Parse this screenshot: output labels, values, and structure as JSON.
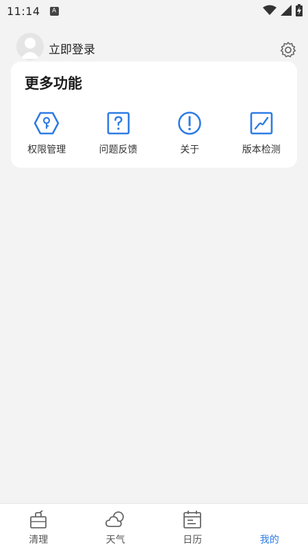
{
  "status_bar": {
    "time": "11:14",
    "notification_badge": "A"
  },
  "header": {
    "login_text": "立即登录"
  },
  "more_functions": {
    "title": "更多功能",
    "items": [
      {
        "label": "权限管理",
        "icon": "permission-key-icon"
      },
      {
        "label": "问题反馈",
        "icon": "feedback-question-icon"
      },
      {
        "label": "关于",
        "icon": "about-exclamation-icon"
      },
      {
        "label": "版本检测",
        "icon": "version-check-chart-icon"
      }
    ]
  },
  "tab_bar": {
    "tabs": [
      {
        "label": "清理",
        "icon": "clean-jar-icon",
        "active": false
      },
      {
        "label": "天气",
        "icon": "weather-cloud-icon",
        "active": false
      },
      {
        "label": "日历",
        "icon": "calendar-icon",
        "active": false
      },
      {
        "label": "我的",
        "icon": "profile-icon",
        "active": true
      }
    ]
  },
  "colors": {
    "accent": "#2d7be5",
    "background": "#f3f3f3",
    "card": "#ffffff"
  }
}
